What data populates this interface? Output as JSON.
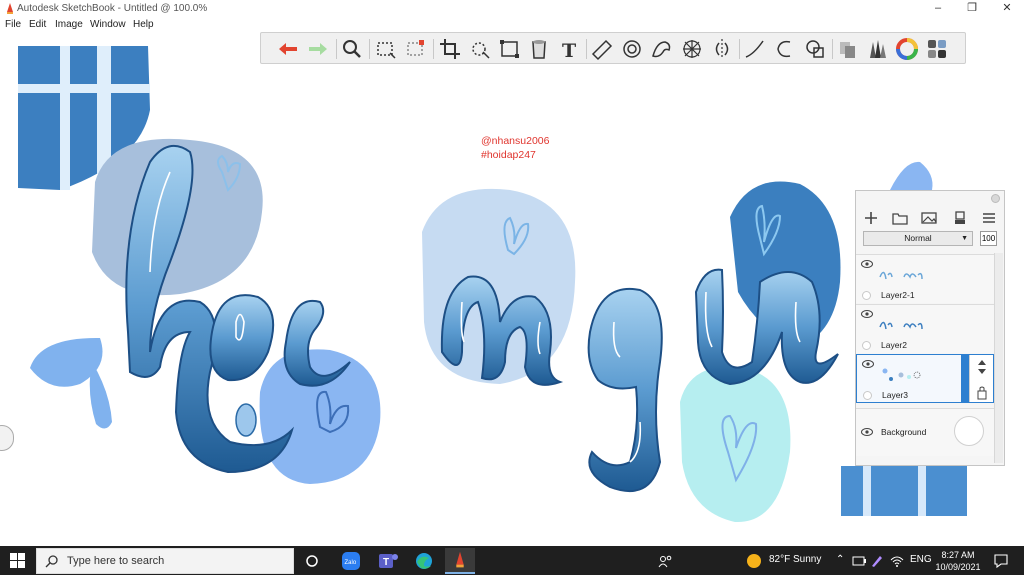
{
  "window": {
    "title": "Autodesk SketchBook - Untitled @ 100.0%",
    "minimize_glyph": "–",
    "maximize_glyph": "❐",
    "close_glyph": "✕"
  },
  "menu": [
    "File",
    "Edit",
    "Image",
    "Window",
    "Help"
  ],
  "toolbar": {
    "tools": [
      "undo-icon",
      "redo-icon",
      "zoom-icon",
      "select-rect-icon",
      "select-lasso-icon",
      "crop-icon",
      "transform-move-icon",
      "distort-icon",
      "fill-bucket-icon",
      "text-icon",
      "ruler-icon",
      "ellipse-guide-icon",
      "french-curve-icon",
      "perspective-icon",
      "symmetry-icon",
      "line-icon",
      "circle-icon",
      "shape-icon",
      "copy-paste-icon",
      "brush-library-icon",
      "color-wheel-icon",
      "brush-set-icon"
    ],
    "text_glyph": "T"
  },
  "watermark": {
    "line1": "@nhansu2006",
    "line2": "#hoidap247"
  },
  "colors": {
    "dark_blue": "#2b6aa6",
    "mid_blue": "#5d93d0",
    "light_blue": "#a9c9ec",
    "pale_blue": "#cfe0f5",
    "cyan_pale": "#b9eef0",
    "accent": "#2d7fd0",
    "undo_red": "#e2442f",
    "redo_green": "#86cf7a"
  },
  "layers_panel": {
    "blend_mode": "Normal",
    "opacity": "100",
    "layers": [
      {
        "name": "Layer2-1",
        "selected": false,
        "visible": true
      },
      {
        "name": "Layer2",
        "selected": false,
        "visible": true
      },
      {
        "name": "Layer3",
        "selected": true,
        "visible": true
      }
    ],
    "background_label": "Background"
  },
  "taskbar": {
    "search_placeholder": "Type here to search",
    "zalo_label": "Zalo",
    "weather": "82°F  Sunny",
    "language": "ENG",
    "time": "8:27 AM",
    "date": "10/09/2021"
  }
}
